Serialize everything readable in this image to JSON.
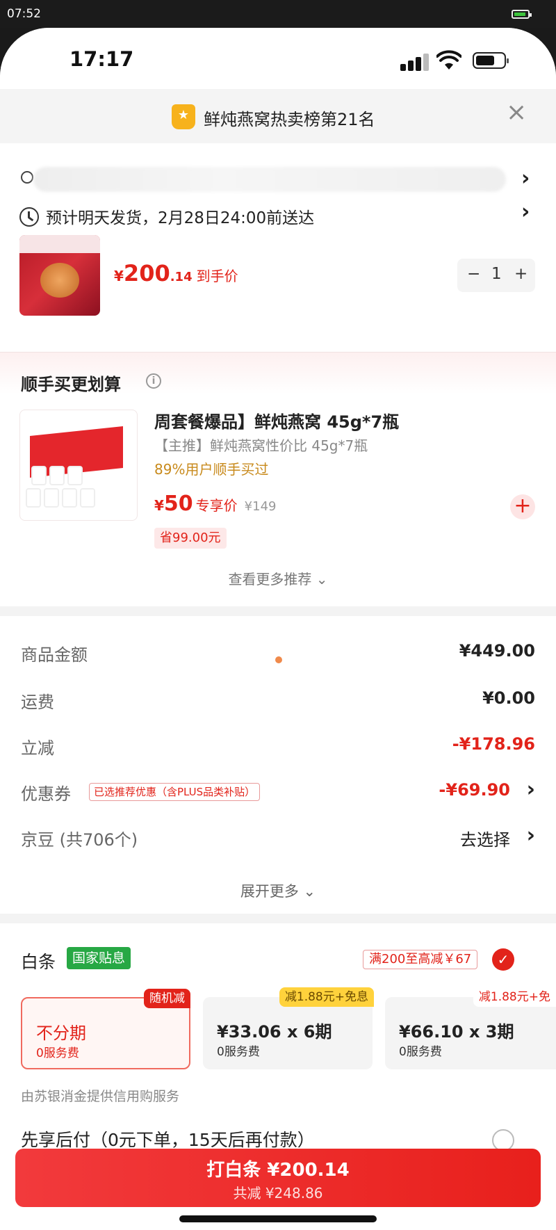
{
  "outer_status": {
    "time": "07:52"
  },
  "ios_status": {
    "time": "17:17"
  },
  "banner": {
    "badge_icon": "crown-icon",
    "text": "鲜炖燕窝热卖榜第21名",
    "close_icon": "close-icon"
  },
  "delivery": {
    "text": "预计明天发货，2月28日24:00前送达"
  },
  "product": {
    "price_symbol": "¥",
    "price_int": "200",
    "price_dec": ".14",
    "price_label": "到手价",
    "quantity": "1",
    "minus": "−",
    "plus": "+"
  },
  "recommend": {
    "title": "顺手买更划算",
    "info": "i",
    "item": {
      "name": "周套餐爆品】鲜炖燕窝 45g*7瓶",
      "subtitle": "【主推】鲜炖燕窝性价比 45g*7瓶",
      "social": "89%用户顺手买过",
      "price_symbol": "¥",
      "price": "50",
      "price_label": "专享价",
      "original_price": "¥149",
      "save": "省99.00元",
      "add": "+"
    },
    "more": "查看更多推荐 ⌄"
  },
  "amounts": {
    "rows": [
      {
        "label": "商品金额",
        "value": "¥449.00"
      },
      {
        "label": "运费",
        "value": "¥0.00"
      },
      {
        "label": "立减",
        "value": "-¥178.96"
      },
      {
        "label": "优惠券",
        "value": "-¥69.90",
        "tag": "已选推荐优惠（含PLUS品类补贴）"
      },
      {
        "label": "京豆 (共706个)",
        "value": "去选择"
      }
    ],
    "expand": "展开更多 ⌄"
  },
  "payment": {
    "title": "白条",
    "gov_tag": "国家贴息",
    "promo": "满200至高减￥67",
    "check": "✓",
    "plans": [
      {
        "main": "不分期",
        "sub": "0服务费",
        "badge": "随机减"
      },
      {
        "main": "¥33.06 x 6期",
        "sub": "0服务费",
        "badge": "减1.88元+免息"
      },
      {
        "main": "¥66.10 x 3期",
        "sub": "0服务费",
        "badge": "减1.88元+免"
      }
    ],
    "provider": "由苏银消金提供信用购服务",
    "later": "先享后付（0元下单，15天后再付款）"
  },
  "pay_button": {
    "main": "打白条 ¥200.14",
    "sub": "共减 ¥248.86"
  },
  "colors": {
    "accent": "#e2231a",
    "green": "#27a844",
    "gold": "#f7b21c"
  }
}
